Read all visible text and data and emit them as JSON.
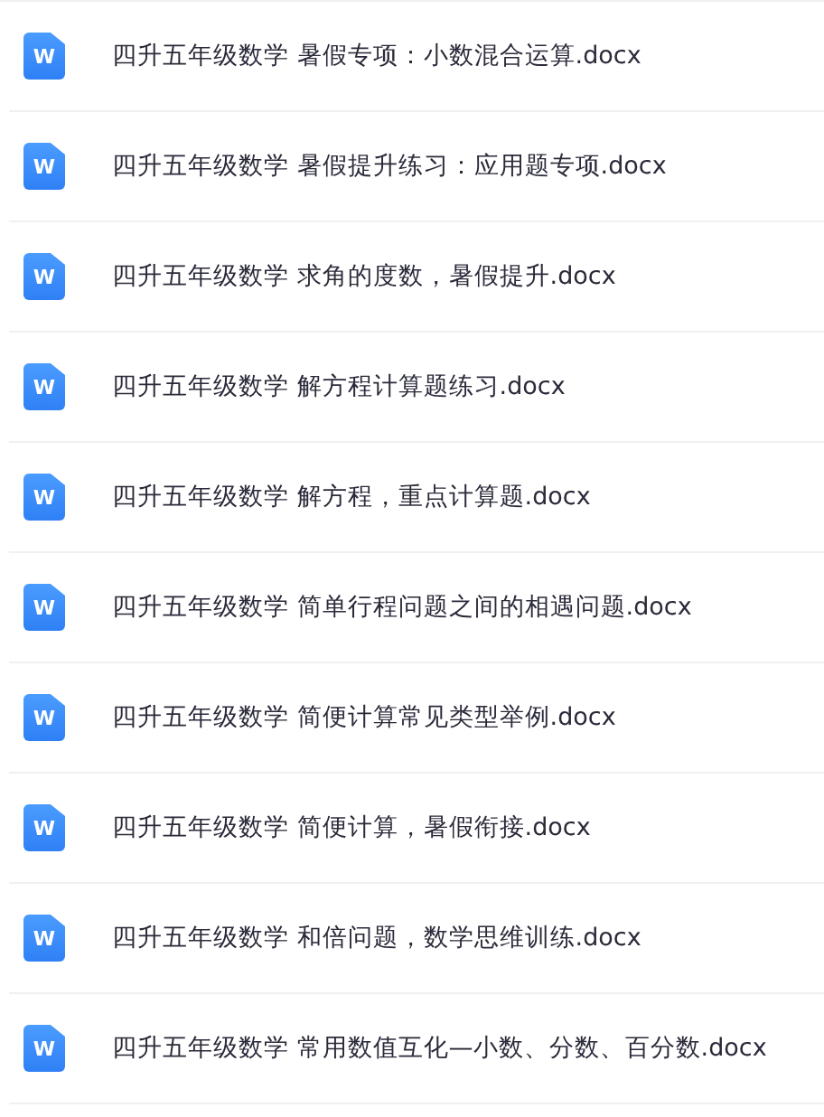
{
  "files": [
    {
      "icon_letter": "W",
      "name": "四升五年级数学 暑假专项：小数混合运算.docx"
    },
    {
      "icon_letter": "W",
      "name": "四升五年级数学 暑假提升练习：应用题专项.docx"
    },
    {
      "icon_letter": "W",
      "name": "四升五年级数学 求角的度数，暑假提升.docx"
    },
    {
      "icon_letter": "W",
      "name": "四升五年级数学 解方程计算题练习.docx"
    },
    {
      "icon_letter": "W",
      "name": "四升五年级数学 解方程，重点计算题.docx"
    },
    {
      "icon_letter": "W",
      "name": "四升五年级数学 简单行程问题之间的相遇问题.docx"
    },
    {
      "icon_letter": "W",
      "name": "四升五年级数学 简便计算常见类型举例.docx"
    },
    {
      "icon_letter": "W",
      "name": "四升五年级数学 简便计算，暑假衔接.docx"
    },
    {
      "icon_letter": "W",
      "name": "四升五年级数学 和倍问题，数学思维训练.docx"
    },
    {
      "icon_letter": "W",
      "name": "四升五年级数学 常用数值互化—小数、分数、百分数.docx"
    }
  ]
}
